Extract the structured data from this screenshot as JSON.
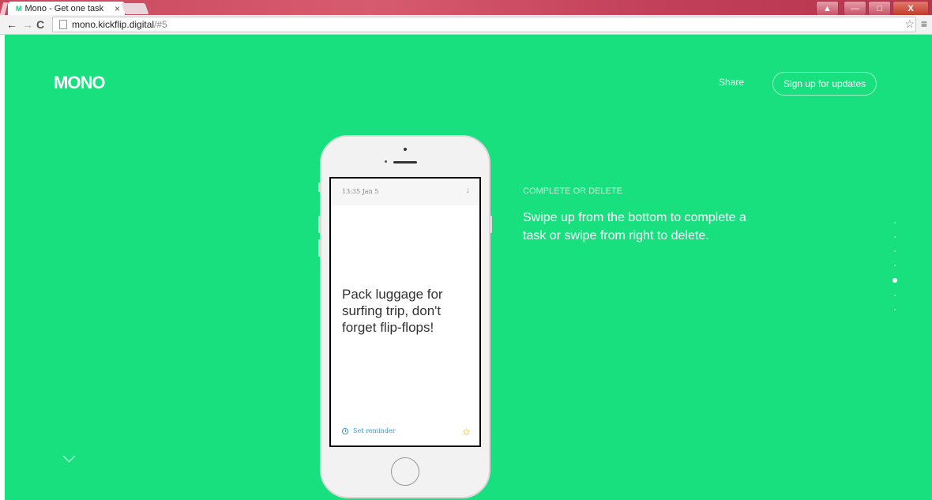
{
  "browser": {
    "tab_title": "Mono - Get one task",
    "tab_favicon": "M",
    "tab_close": "×",
    "url_host": "mono.kickflip.digital",
    "url_path": "/#5",
    "window_controls": {
      "minimize": "—",
      "maximize": "□",
      "close": "X"
    }
  },
  "header": {
    "logo": "MONO",
    "share_label": "Share",
    "signup_label": "Sign up for updates"
  },
  "phone": {
    "time": "13:35  Jan 5",
    "arrow": "↓",
    "task": "Pack luggage for surfing trip, don't forget flip-flops!",
    "reminder_label": "Set reminder",
    "sun": "☼"
  },
  "section": {
    "label": "COMPLETE OR DELETE",
    "body": "Swipe up from the bottom to complete a task or swipe from right to delete."
  },
  "pager": {
    "count": 7,
    "active_index": 4
  },
  "colors": {
    "background": "#18e07f",
    "accent_blue": "#2a9ed8",
    "sun": "#f2b122"
  }
}
